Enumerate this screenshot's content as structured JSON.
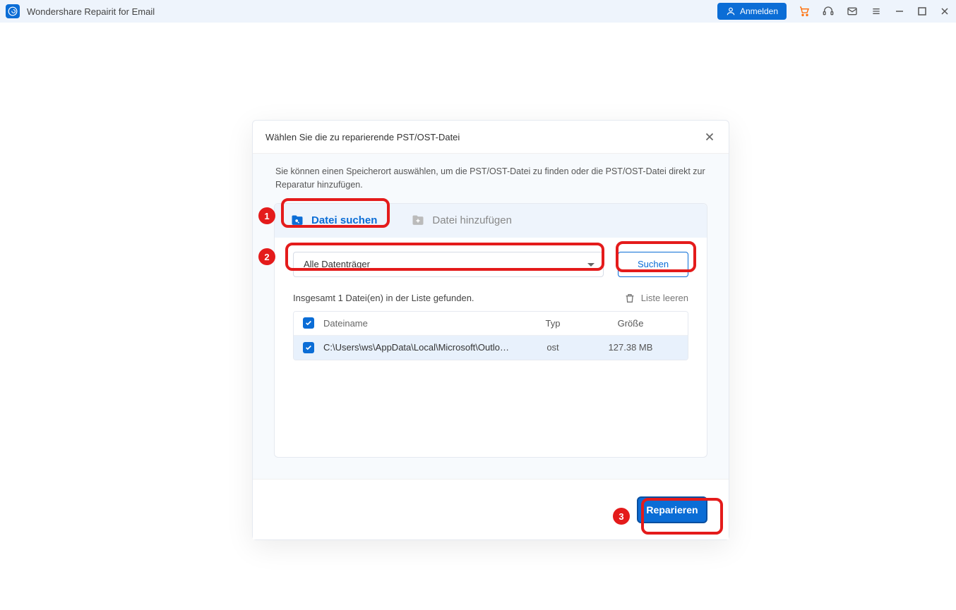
{
  "titlebar": {
    "app_title": "Wondershare Repairit for Email",
    "login_label": "Anmelden"
  },
  "dialog": {
    "title": "Wählen Sie die zu reparierende PST/OST-Datei",
    "desc": "Sie können einen Speicherort auswählen, um die PST/OST-Datei zu finden oder die PST/OST-Datei direkt zur Reparatur hinzufügen.",
    "tab_search": "Datei suchen",
    "tab_add": "Datei hinzufügen",
    "dropdown_value": "Alle Datenträger",
    "search_btn": "Suchen",
    "found_text": "Insgesamt 1 Datei(en) in der Liste gefunden.",
    "clear_list": "Liste leeren",
    "col_name": "Dateiname",
    "col_type": "Typ",
    "col_size": "Größe",
    "rows": [
      {
        "path": "C:\\Users\\ws\\AppData\\Local\\Microsoft\\Outlook\\wangxiy...",
        "typ": "ost",
        "size": "127.38  MB"
      }
    ],
    "repair_btn": "Reparieren"
  },
  "anno": {
    "n1": "1",
    "n2": "2",
    "n3": "3"
  }
}
